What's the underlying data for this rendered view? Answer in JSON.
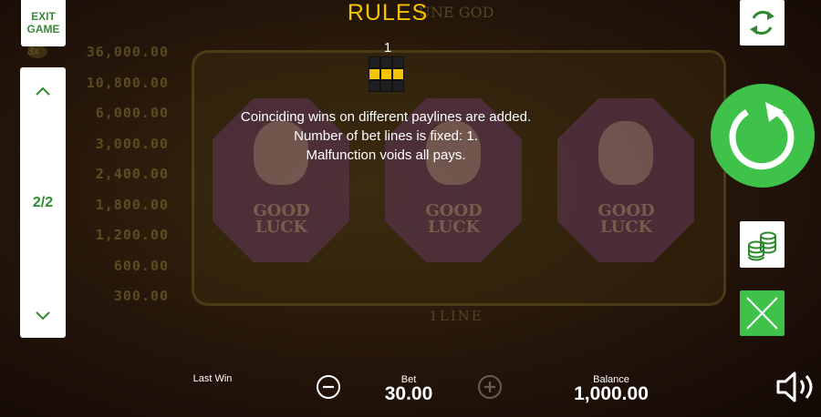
{
  "background": {
    "top_decoration": "UNE GOD",
    "paytable": [
      {
        "multiplier": "3x",
        "amount": "36,000.00"
      },
      {
        "multiplier": "",
        "amount": "10,800.00"
      },
      {
        "multiplier": "",
        "amount": "6,000.00"
      },
      {
        "multiplier": "",
        "amount": "3,000.00"
      },
      {
        "multiplier": "",
        "amount": "2,400.00"
      },
      {
        "multiplier": "",
        "amount": "1,800.00"
      },
      {
        "multiplier": "",
        "amount": "1,200.00"
      },
      {
        "multiplier": "",
        "amount": "600.00"
      },
      {
        "multiplier": "",
        "amount": "300.00"
      }
    ],
    "reel_symbol_text": [
      "GOOD\nLUCK",
      "GOOD\nLUCK",
      "GOOD\nLUCK"
    ],
    "line_label": "1LINE"
  },
  "rules": {
    "title": "RULES",
    "payline_number": "1",
    "payline_pattern": [
      0,
      0,
      0,
      1,
      1,
      1,
      0,
      0,
      0
    ],
    "lines": [
      "Coinciding wins on different paylines are added.",
      "Number of bet lines is fixed: 1.",
      "Malfunction voids all pays."
    ]
  },
  "left_controls": {
    "exit_label_1": "EXIT",
    "exit_label_2": "GAME",
    "page_indicator": "2/2",
    "up_icon": "chevron-up-icon",
    "down_icon": "chevron-down-icon"
  },
  "right_controls": {
    "autoplay_icon": "refresh-icon",
    "spin_icon": "spin-arrow-icon",
    "coins_icon": "coins-stack-icon",
    "close_icon": "close-x-icon"
  },
  "bottom_bar": {
    "last_win_label": "Last Win",
    "last_win_value": "",
    "bet_label": "Bet",
    "bet_value": "30.00",
    "balance_label": "Balance",
    "balance_value": "1,000.00",
    "minus_icon": "minus-circle-icon",
    "plus_icon": "plus-circle-icon",
    "sound_icon": "speaker-icon"
  },
  "colors": {
    "accent_green": "#3ec24a",
    "title_yellow": "#f5c400",
    "label_green": "#2e8a2e"
  }
}
